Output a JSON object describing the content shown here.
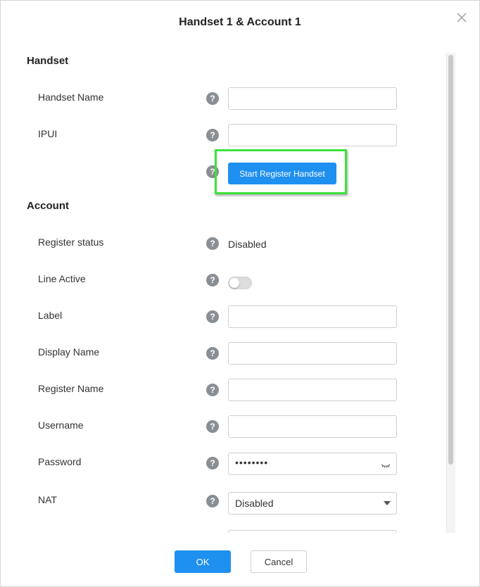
{
  "dialog": {
    "title": "Handset 1 & Account 1",
    "close_icon": "close-icon"
  },
  "handset_section": {
    "title": "Handset",
    "fields": {
      "handset_name": {
        "label": "Handset Name",
        "value": ""
      },
      "ipui": {
        "label": "IPUI",
        "value": ""
      }
    },
    "register_button": "Start Register Handset"
  },
  "account_section": {
    "title": "Account",
    "register_status": {
      "label": "Register status",
      "value": "Disabled"
    },
    "line_active": {
      "label": "Line Active",
      "checked": false
    },
    "label_field": {
      "label": "Label",
      "value": ""
    },
    "display_name": {
      "label": "Display Name",
      "value": ""
    },
    "register_name": {
      "label": "Register Name",
      "value": ""
    },
    "username": {
      "label": "Username",
      "value": ""
    },
    "password": {
      "label": "Password",
      "value": "••••••••",
      "icon": "eye-hidden-icon"
    },
    "nat": {
      "label": "NAT",
      "value": "Disabled"
    }
  },
  "help_icon": "?",
  "footer": {
    "ok": "OK",
    "cancel": "Cancel"
  },
  "colors": {
    "primary": "#1e90f0",
    "highlight": "#3ce33c",
    "help_icon_bg": "#8a8f94"
  }
}
